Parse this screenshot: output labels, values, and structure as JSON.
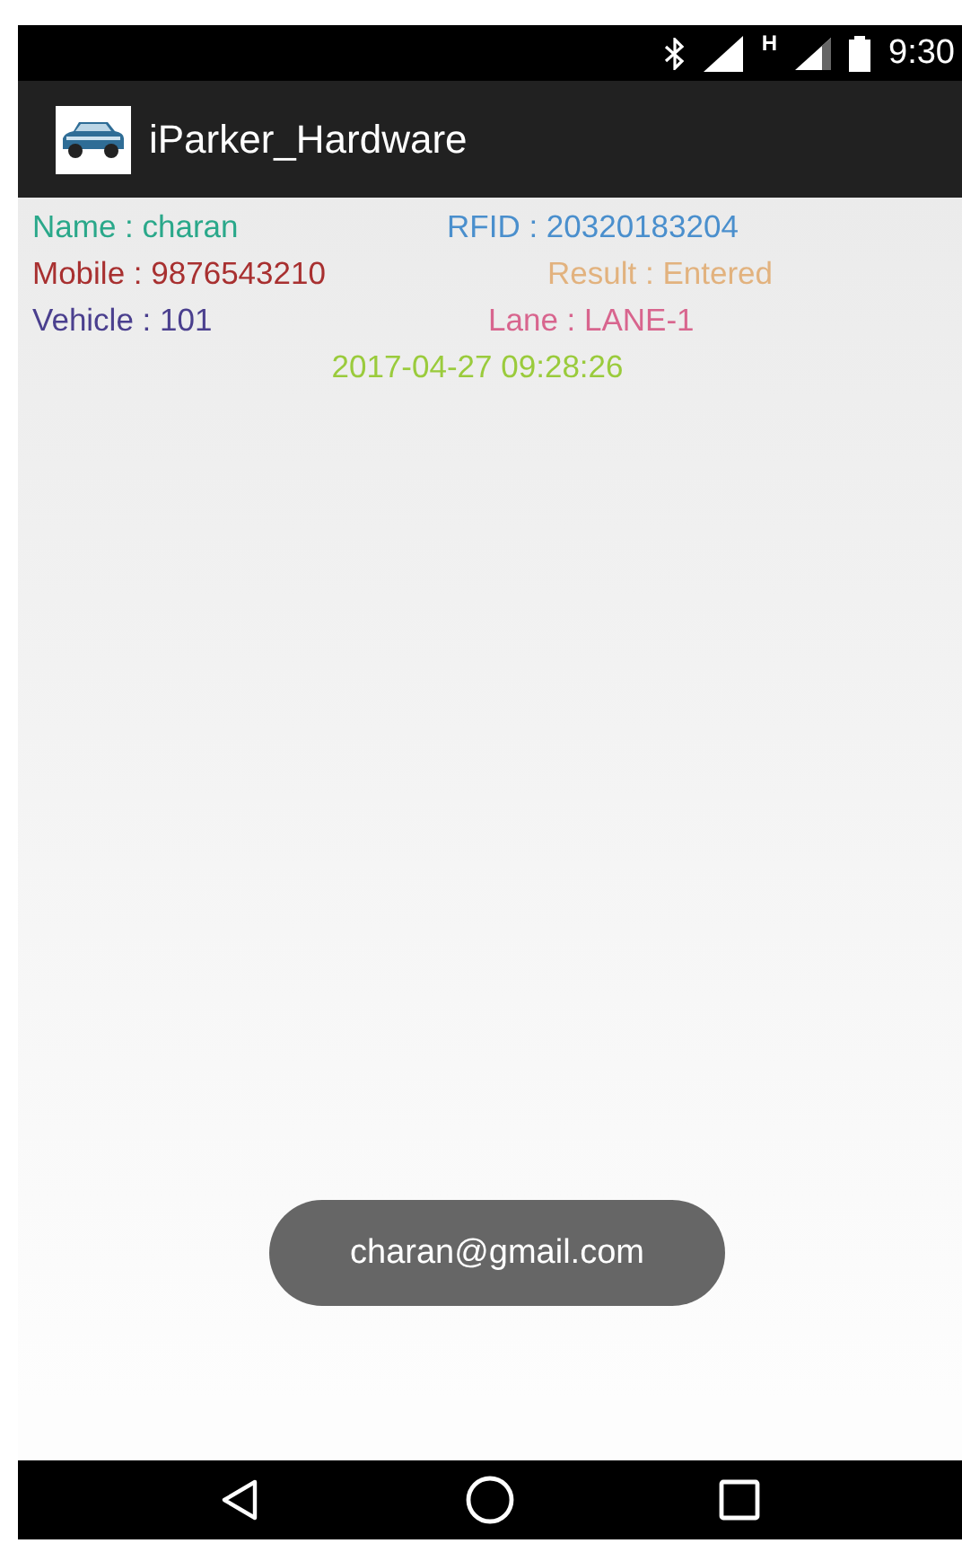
{
  "status_bar": {
    "network_type": "H",
    "time": "9:30"
  },
  "app_bar": {
    "title": "iParker_Hardware"
  },
  "fields": [
    {
      "text": "Name : charan",
      "color": "#2aa88a"
    },
    {
      "text": "RFID : 20320183204",
      "color": "#4a8fcd"
    },
    {
      "text": "Mobile : 9876543210",
      "color": "#a83030"
    },
    {
      "text": "Result : Entered",
      "color": "#e2b27e"
    },
    {
      "text": "Vehicle : 101",
      "color": "#4a3f8e"
    },
    {
      "text": "Lane : LANE-1",
      "color": "#d8658e"
    }
  ],
  "timestamp": {
    "text": "2017-04-27 09:28:26",
    "color": "#9acb3c"
  },
  "toast": "charan@gmail.com"
}
